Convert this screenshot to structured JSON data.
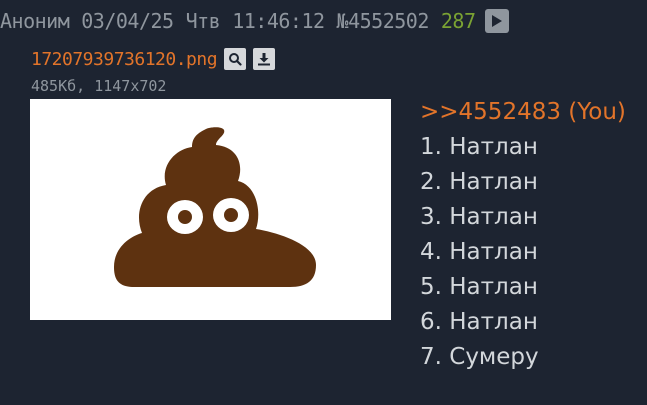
{
  "post": {
    "author": "Аноним",
    "date": "03/04/25",
    "weekday": "Чтв",
    "time": "11:46:12",
    "number": "№4552502",
    "reply_count": "287",
    "play_icon": "play-icon"
  },
  "file": {
    "name": "17207939736120.png",
    "size": "485Кб",
    "dimensions": "1147x702",
    "search_icon": "magnifier-icon",
    "download_icon": "download-icon"
  },
  "colors": {
    "background": "#1d2431",
    "header_text": "#8f969e",
    "reply_count": "#7aa233",
    "link": "#e2742a",
    "body_text": "#d3d7db",
    "poop": "#5e3210"
  },
  "message": {
    "reply_link": ">>4552483 (You)",
    "lines": [
      "1. Натлан",
      "2. Натлан",
      "3. Натлан",
      "4. Натлан",
      "5. Натлан",
      "6. Натлан",
      "7. Сумеру"
    ]
  }
}
